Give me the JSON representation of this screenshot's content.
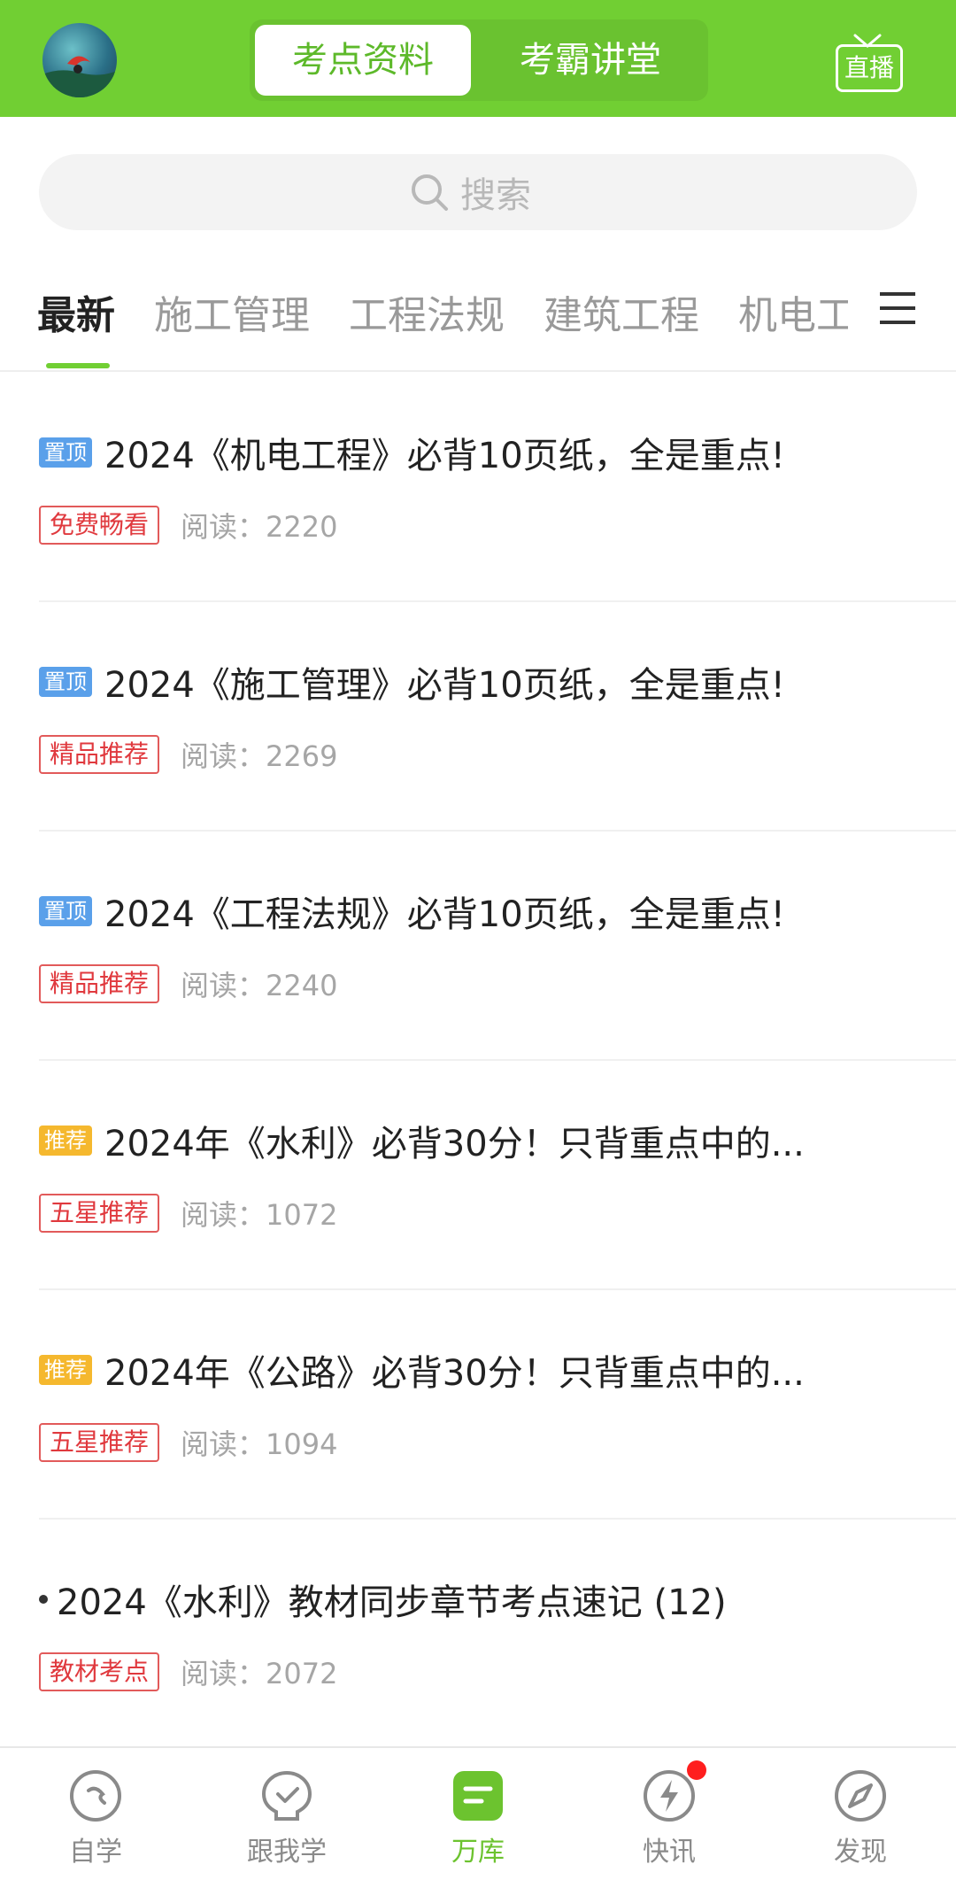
{
  "header": {
    "tabs": [
      {
        "label": "考点资料",
        "active": true
      },
      {
        "label": "考霸讲堂",
        "active": false
      }
    ],
    "live_label": "直播",
    "accent_color": "#71cf33"
  },
  "search": {
    "placeholder": "搜索"
  },
  "categories": {
    "items": [
      "最新",
      "施工管理",
      "工程法规",
      "建筑工程",
      "机电工"
    ],
    "active_index": 0
  },
  "articles": [
    {
      "tag": "置顶",
      "tag_type": "top",
      "title": "2024《机电工程》必背10页纸，全是重点!",
      "badge": "免费畅看",
      "reads": "阅读：2220"
    },
    {
      "tag": "置顶",
      "tag_type": "top",
      "title": "2024《施工管理》必背10页纸，全是重点!",
      "badge": "精品推荐",
      "reads": "阅读：2269"
    },
    {
      "tag": "置顶",
      "tag_type": "top",
      "title": "2024《工程法规》必背10页纸，全是重点!",
      "badge": "精品推荐",
      "reads": "阅读：2240"
    },
    {
      "tag": "推荐",
      "tag_type": "rec",
      "title": "2024年《水利》必背30分！只背重点中的...",
      "badge": "五星推荐",
      "reads": "阅读：1072"
    },
    {
      "tag": "推荐",
      "tag_type": "rec",
      "title": "2024年《公路》必背30分！只背重点中的...",
      "badge": "五星推荐",
      "reads": "阅读：1094"
    },
    {
      "tag": "",
      "tag_type": "bullet",
      "title": "2024《水利》教材同步章节考点速记 (12)",
      "badge": "教材考点",
      "reads": "阅读：2072"
    }
  ],
  "tabbar": {
    "items": [
      {
        "label": "自学",
        "icon": "self-study-icon",
        "active": false
      },
      {
        "label": "跟我学",
        "icon": "follow-study-icon",
        "active": false
      },
      {
        "label": "万库",
        "icon": "library-icon",
        "active": true
      },
      {
        "label": "快讯",
        "icon": "flash-news-icon",
        "active": false,
        "notification": true
      },
      {
        "label": "发现",
        "icon": "compass-icon",
        "active": false
      }
    ]
  }
}
